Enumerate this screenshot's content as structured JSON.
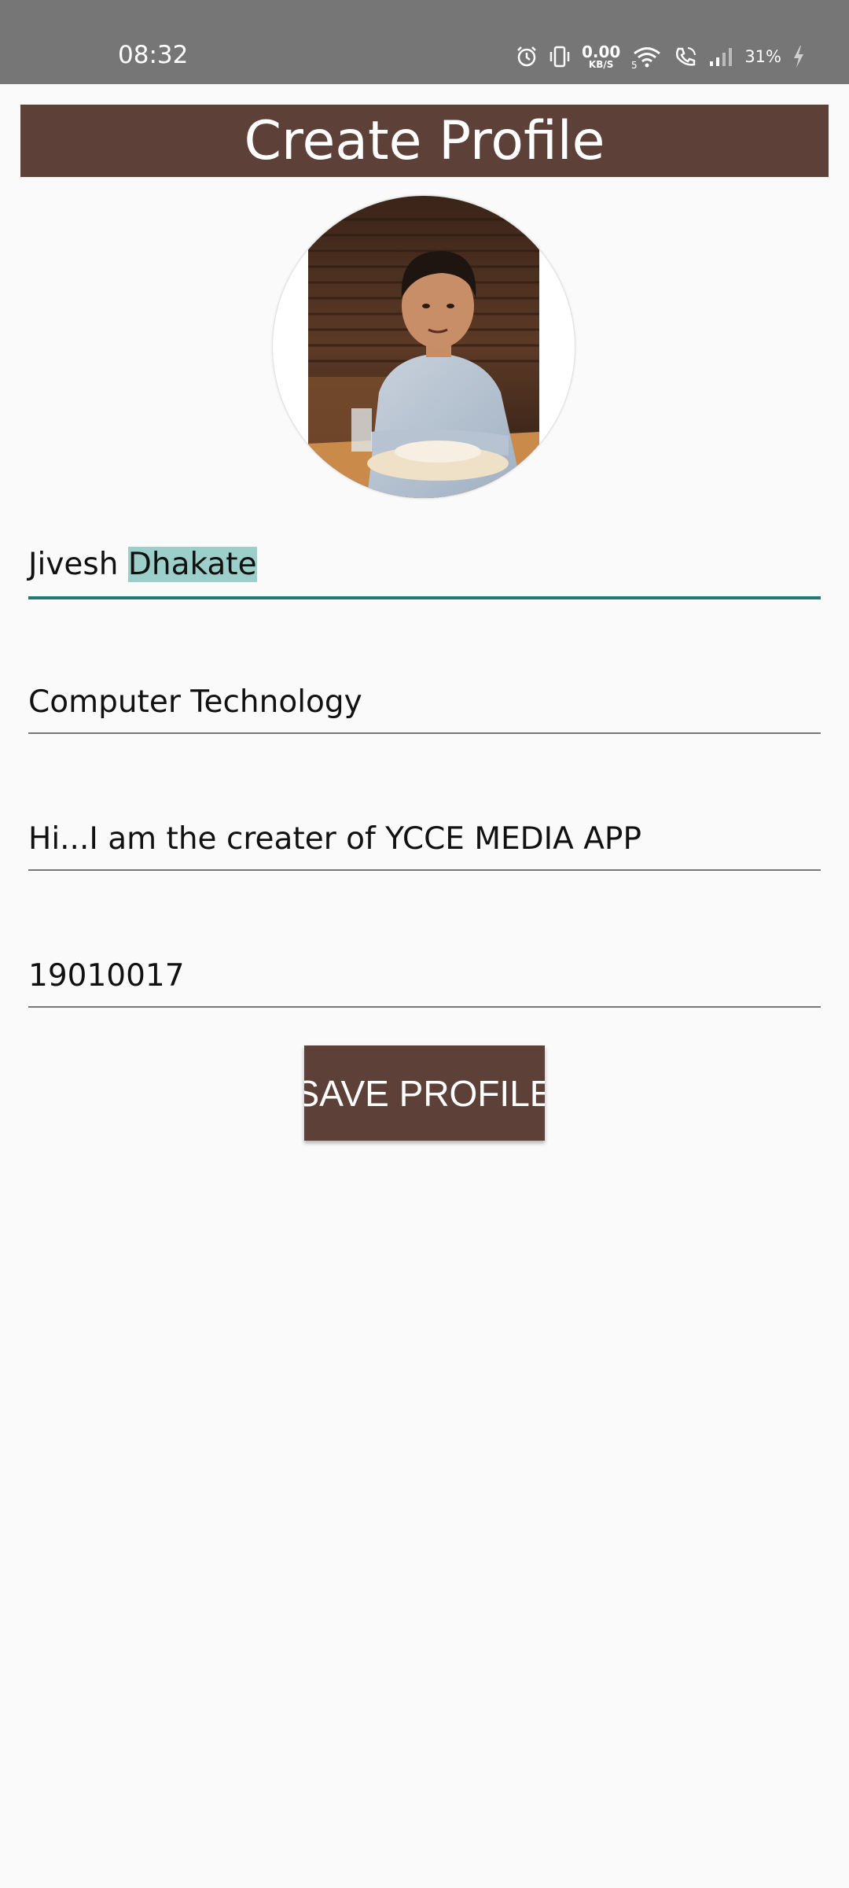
{
  "status_bar": {
    "time": "08:32",
    "net_speed_value": "0.00",
    "net_speed_unit": "KB/S",
    "battery_percent": "31%",
    "icons": [
      "alarm-icon",
      "vibrate-icon",
      "wifi-icon",
      "wifi-calling-icon",
      "signal-icon",
      "battery-charging-icon"
    ]
  },
  "header": {
    "title": "Create Profile"
  },
  "profile": {
    "avatar_icon": "profile-photo"
  },
  "form": {
    "name_first": "Jivesh",
    "name_selected": "Dhakate",
    "department": "Computer Technology",
    "bio": "Hi...I am the creater of YCCE MEDIA APP",
    "id_number": "19010017"
  },
  "actions": {
    "save_label": "SAVE PROFILE"
  },
  "colors": {
    "status_bar": "#767676",
    "primary_brown": "#5d4037",
    "accent_teal": "#1f7a75",
    "selection": "#9dcfca",
    "background": "#fafafa"
  }
}
